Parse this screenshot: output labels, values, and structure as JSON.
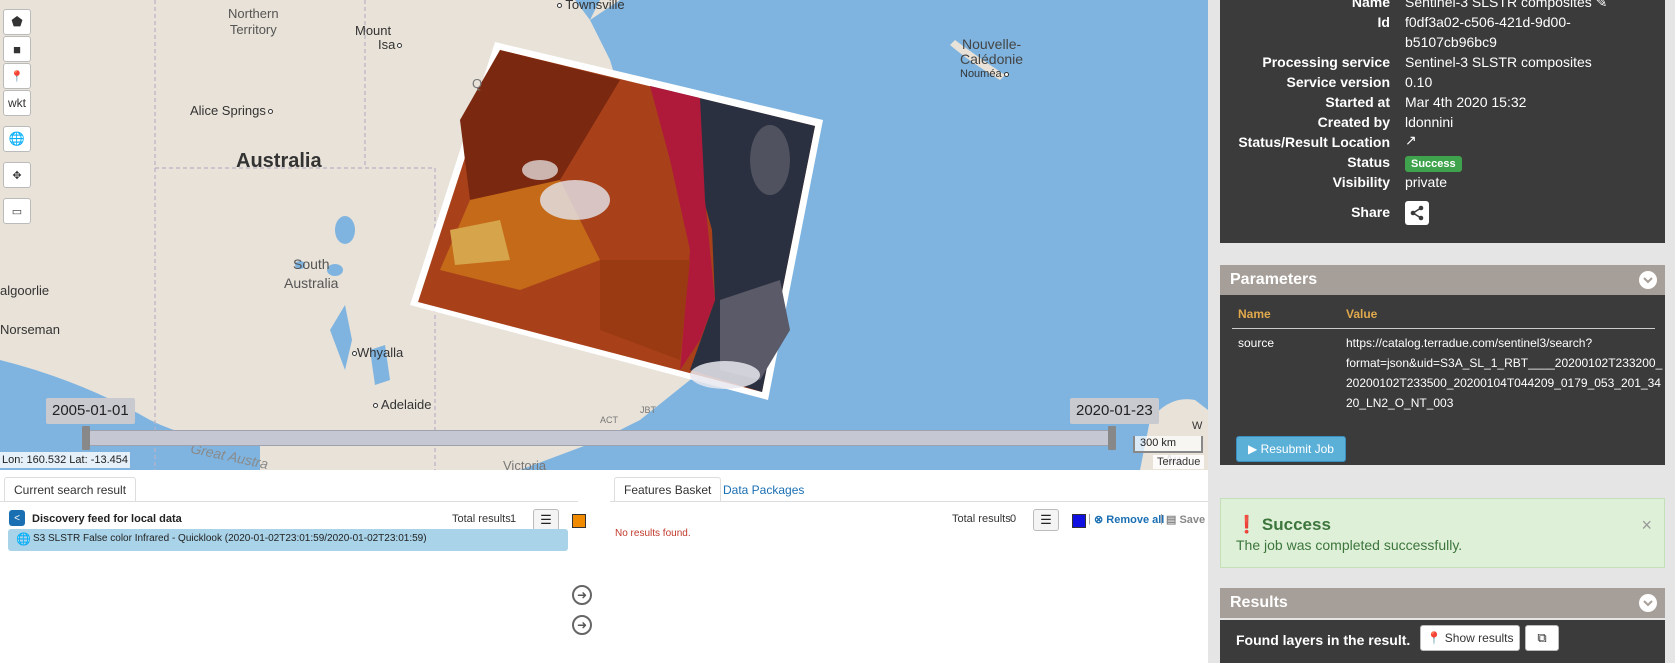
{
  "map": {
    "labels": {
      "northern_territory": "Northern\nTerritory",
      "townsville": "Townsville",
      "mount_isa_1": "Mount",
      "mount_isa_2": "Isa",
      "alice_springs": "Alice Springs",
      "australia": "Australia",
      "south_australia_1": "South",
      "south_australia_2": "Australia",
      "kalgoorlie": "algoorlie",
      "norseman": "Norseman",
      "whyalla": "Whyalla",
      "adelaide": "Adelaide",
      "victoria": "Victoria",
      "great_australian": "Great Austra",
      "nouvelle_1": "Nouvelle-",
      "nouvelle_2": "Calédonie",
      "noumea": "Nouméa",
      "q_partial": "Q",
      "act": "ACT",
      "jbt": "JBT",
      "au_partial": "Au",
      "w_partial": "W"
    },
    "tools": {
      "wkt_label": "wkt"
    },
    "timeline": {
      "start": "2005-01-01",
      "end": "2020-01-23"
    },
    "scale": "300 km",
    "coords": "Lon: 160.532 Lat: -13.454",
    "attribution": "Terradue"
  },
  "left_panel": {
    "tab_label": "Current search result",
    "feed_title": "Discovery feed for local data",
    "total_label": "Total results",
    "total_value": "1",
    "swatch_color": "#f08a00",
    "result_text": "S3 SLSTR False color Infrared - Quicklook (2020-01-02T23:01:59/2020-01-02T23:01:59)"
  },
  "right_panel": {
    "tab_basket": "Features Basket",
    "tab_packages": "Data Packages",
    "total_label": "Total results",
    "total_value": "0",
    "swatch_color": "#1010e0",
    "remove_all": "Remove all",
    "separator": "|",
    "save": "Save",
    "no_results": "No results found."
  },
  "sidebar": {
    "job": {
      "name_label": "Name",
      "name_value": "Sentinel-3 SLSTR composites",
      "id_label": "Id",
      "id_value_1": "f0df3a02-c506-421d-9d00-",
      "id_value_2": "b5107cb96bc9",
      "service_label": "Processing service",
      "service_value": "Sentinel-3 SLSTR composites",
      "version_label": "Service version",
      "version_value": "0.10",
      "started_label": "Started at",
      "started_value": "Mar 4th 2020 15:32",
      "created_label": "Created by",
      "created_value": "ldonnini",
      "location_label": "Status/Result Location",
      "status_label": "Status",
      "status_value": "Success",
      "visibility_label": "Visibility",
      "visibility_value": "private",
      "share_label": "Share"
    },
    "parameters": {
      "title": "Parameters",
      "col_name": "Name",
      "col_value": "Value",
      "rows": [
        {
          "name": "source",
          "value_1": "https://catalog.terradue.com/sentinel3/search?",
          "value_2": "format=json&uid=S3A_SL_1_RBT____20200102T233200_",
          "value_3": "20200102T233500_20200104T044209_0179_053_201_34",
          "value_4": "20_LN2_O_NT_003"
        }
      ],
      "resubmit_label": "Resubmit Job"
    },
    "alert": {
      "title": "Success",
      "text": "The job was completed successfully.",
      "close": "×"
    },
    "results": {
      "title": "Results",
      "found_text": "Found layers in the result.",
      "show_label": "Show results"
    }
  }
}
